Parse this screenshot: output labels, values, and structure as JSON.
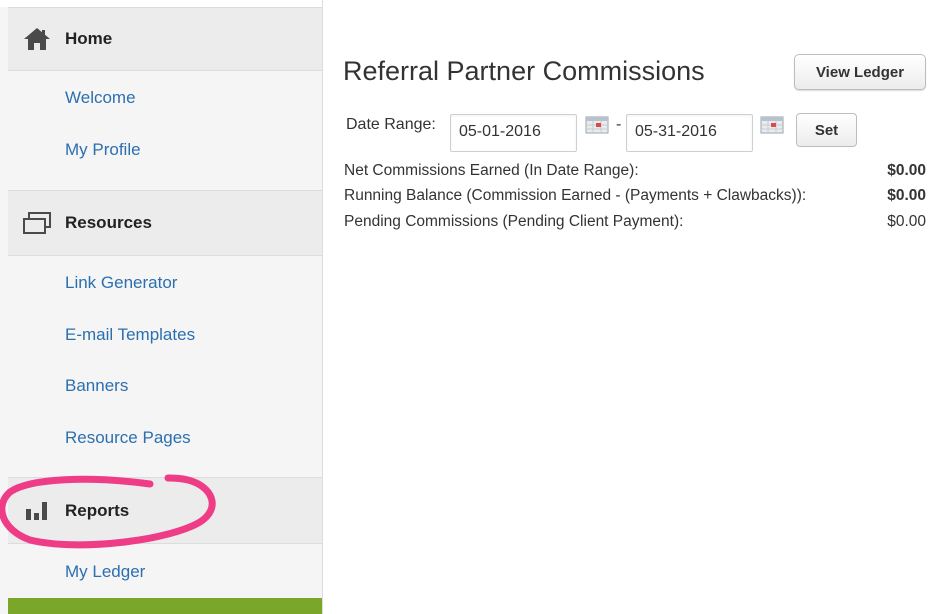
{
  "sidebar": {
    "sections": [
      {
        "header": "Home",
        "icon": "home-icon",
        "items": [
          "Welcome",
          "My Profile"
        ]
      },
      {
        "header": "Resources",
        "icon": "windows-icon",
        "items": [
          "Link Generator",
          "E-mail Templates",
          "Banners",
          "Resource Pages"
        ]
      },
      {
        "header": "Reports",
        "icon": "bar-chart-icon",
        "items": [
          "My Ledger"
        ]
      }
    ],
    "active_color": "#7aa72a",
    "link_color": "#2c6fb0",
    "annotation_color": "#ee3d86"
  },
  "main": {
    "title": "Referral Partner Commissions",
    "view_ledger_label": "View Ledger",
    "date_range_label": "Date Range:",
    "start_date": "05-01-2016",
    "date_separator": "-",
    "end_date": "05-31-2016",
    "set_label": "Set",
    "summary": [
      {
        "label": "Net Commissions Earned (In Date Range):",
        "value": "$0.00"
      },
      {
        "label": "Running Balance (Commission Earned - (Payments + Clawbacks)):",
        "value": "$0.00"
      },
      {
        "label": "Pending Commissions (Pending Client Payment):",
        "value": "$0.00"
      }
    ]
  }
}
